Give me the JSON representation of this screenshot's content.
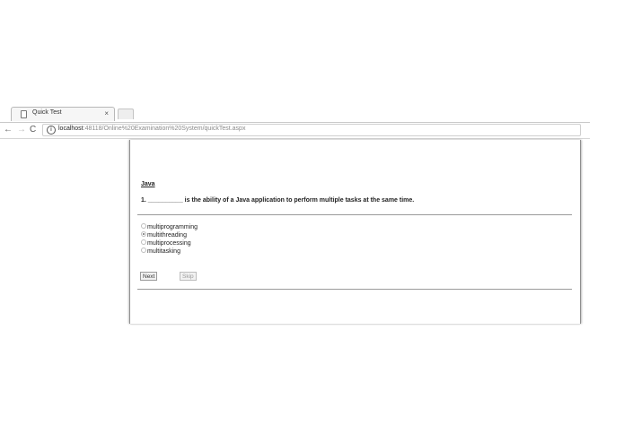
{
  "browser": {
    "tab_title": "Quick Test",
    "tab_close": "×",
    "url_host": "localhost",
    "url_path": ":48118/Online%20Examination%20System/quickTest.aspx",
    "back_glyph": "←",
    "forward_glyph": "→",
    "reload_glyph": "C",
    "info_glyph": "i"
  },
  "quiz": {
    "subject": "Java",
    "question": "1. __________ is the ability of a Java application to perform multiple tasks at the same time.",
    "options": [
      {
        "label": "multiprogramming",
        "selected": false
      },
      {
        "label": "multithreading",
        "selected": true
      },
      {
        "label": "multiprocessing",
        "selected": false
      },
      {
        "label": "multitasking",
        "selected": false
      }
    ],
    "next_label": "Next",
    "skip_label": "Skip"
  }
}
